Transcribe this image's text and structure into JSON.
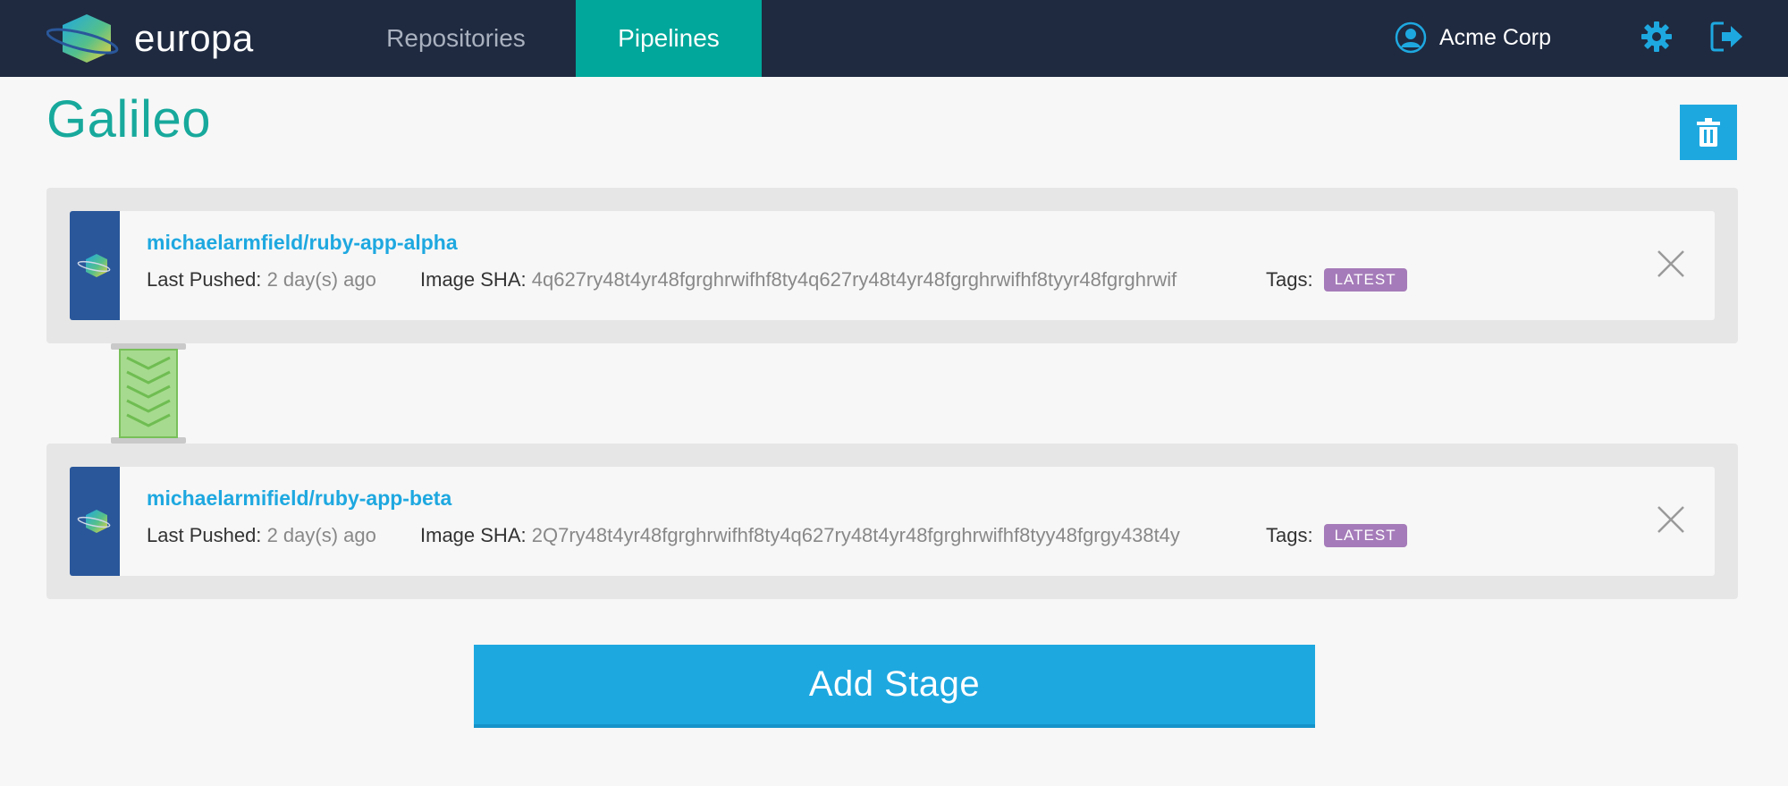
{
  "header": {
    "logo_text": "europa",
    "tabs": [
      {
        "label": "Repositories",
        "active": false
      },
      {
        "label": "Pipelines",
        "active": true
      }
    ],
    "account_name": "Acme Corp",
    "icons": [
      "user-icon",
      "gear-icon",
      "logout-icon"
    ]
  },
  "page": {
    "title": "Galileo",
    "delete_icon": "trash-icon"
  },
  "stages": [
    {
      "repo": "michaelarmfield/ruby-app-alpha",
      "last_pushed_label": "Last Pushed:",
      "last_pushed_value": "2 day(s) ago",
      "sha_label": "Image SHA:",
      "sha_value": "4q627ry48t4yr48fgrghrwifhf8ty4q627ry48t4yr48fgrghrwifhf8tyyr48fgrghrwif",
      "tags_label": "Tags:",
      "tag": "LATEST"
    },
    {
      "repo": "michaelarmifield/ruby-app-beta",
      "last_pushed_label": "Last Pushed:",
      "last_pushed_value": "2 day(s) ago",
      "sha_label": "Image SHA:",
      "sha_value": "2Q7ry48t4yr48fgrghrwifhf8ty4q627ry48t4yr48fgrghrwifhf8tyy48fgrgy438t4y",
      "tags_label": "Tags:",
      "tag": "LATEST"
    }
  ],
  "add_stage_label": "Add Stage",
  "colors": {
    "header_bg": "#1f2a40",
    "accent_teal": "#00a79a",
    "accent_blue": "#1ea8e0",
    "stripe_blue": "#2a579a",
    "tag_purple": "#a57bb9",
    "connector_green": "#a6da8e"
  }
}
